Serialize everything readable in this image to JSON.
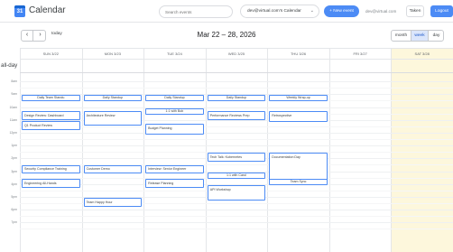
{
  "header": {
    "app_title": "Calendar",
    "logo_text": "31",
    "search_placeholder": "Search events",
    "calendar_select": "dev@virtual.com's Calendar",
    "new_event_label": "+ New event",
    "user_email": "dev@virtual.com",
    "taken_label": "Taken",
    "logout_label": "Logout"
  },
  "toolbar": {
    "prev": "‹",
    "next": "›",
    "today_label": "today",
    "range_title": "Mar 22 – 28, 2026",
    "views": [
      "month",
      "week",
      "day"
    ],
    "active_view": "week"
  },
  "days": [
    "SUN 3/22",
    "MON 3/23",
    "TUE 3/24",
    "WED 3/25",
    "THU 3/26",
    "FRI 3/27",
    "SAT 3/28"
  ],
  "today_index": 6,
  "allday_label": "all-day",
  "time_labels": [
    "8am",
    "9am",
    "10am",
    "11am",
    "12pm",
    "1pm",
    "2pm",
    "3pm",
    "4pm",
    "5pm",
    "6pm",
    "7pm"
  ],
  "events": [
    {
      "title": "Daily Team Standu",
      "day": 0,
      "start": "9:00"
    },
    {
      "title": "Daily Standup",
      "day": 1,
      "start": "9:00"
    },
    {
      "title": "Daily Standup",
      "day": 2,
      "start": "9:00"
    },
    {
      "title": "Daily Standup",
      "day": 3,
      "start": "9:00"
    },
    {
      "title": "Weekly Wrap-up",
      "day": 4,
      "start": "9:00"
    },
    {
      "title": "1:1 with Bob",
      "day": 2,
      "start": "10:00"
    },
    {
      "title": "Design Review: Dashboard",
      "day": 0,
      "start": "10:15"
    },
    {
      "title": "Architecture Review",
      "day": 1,
      "start": "10:15"
    },
    {
      "title": "Performance Reviews Prep",
      "day": 3,
      "start": "10:15"
    },
    {
      "title": "Retrospective",
      "day": 4,
      "start": "10:15"
    },
    {
      "title": "Q1 Product Review",
      "day": 0,
      "start": "11:00"
    },
    {
      "title": "Budget Planning",
      "day": 2,
      "start": "11:15"
    },
    {
      "title": "Tech Talk: Kubernetes",
      "day": 3,
      "start": "1:30"
    },
    {
      "title": "Documentation Day",
      "day": 4,
      "start": "1:30"
    },
    {
      "title": "Security Compliance Training",
      "day": 0,
      "start": "2:30"
    },
    {
      "title": "Customer Demo",
      "day": 1,
      "start": "2:30"
    },
    {
      "title": "Interview: Senior Engineer",
      "day": 2,
      "start": "2:30"
    },
    {
      "title": "1:1 with Carol",
      "day": 3,
      "start": "3:00"
    },
    {
      "title": "Team Sync",
      "day": 4,
      "start": "3:30"
    },
    {
      "title": "Engineering All-Hands",
      "day": 0,
      "start": "3:30"
    },
    {
      "title": "Release Planning",
      "day": 2,
      "start": "3:30"
    },
    {
      "title": "API Workshop",
      "day": 3,
      "start": "4:00"
    },
    {
      "title": "Team Happy Hour",
      "day": 1,
      "start": "5:00"
    }
  ]
}
